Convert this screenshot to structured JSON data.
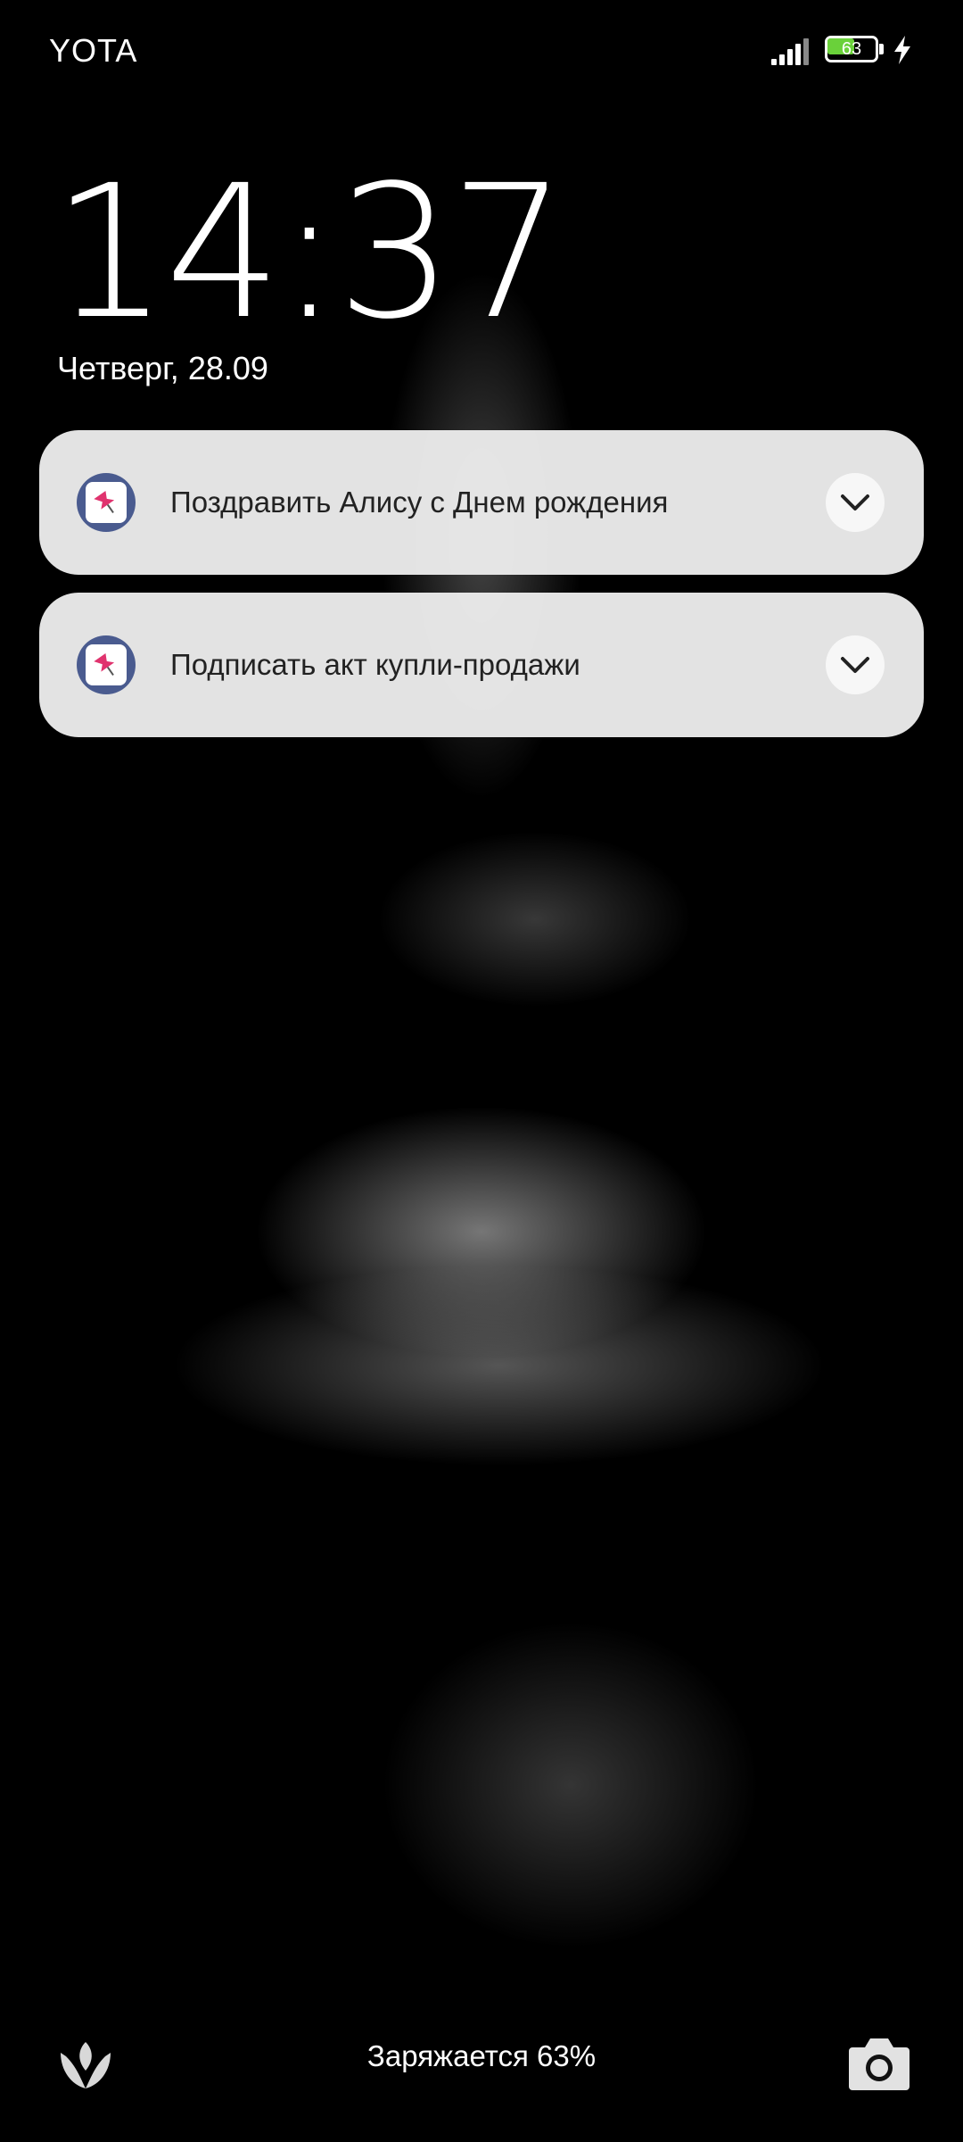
{
  "status_bar": {
    "carrier": "YOTA",
    "battery_level": "63",
    "battery_fraction": 0.63,
    "battery_fill_color": "#6ad13a",
    "signal_icon": "signal-bars-icon",
    "charging_icon": "bolt-icon"
  },
  "lockscreen": {
    "time": "14:37",
    "date": "Четверг, 28.09"
  },
  "notifications": [
    {
      "icon": "pin-app-icon",
      "title": "Поздравить Алису с Днем рождения",
      "expand_icon": "chevron-down-icon"
    },
    {
      "icon": "pin-app-icon",
      "title": "Подписать акт купли-продажи",
      "expand_icon": "chevron-down-icon"
    }
  ],
  "bottom_bar": {
    "left_shortcut_icon": "tulip-icon",
    "charging_status": "Заряжается 63%",
    "right_shortcut_icon": "camera-icon"
  },
  "colors": {
    "app_icon_ring": "#4a5b8f",
    "pin_accent": "#e0336e",
    "notification_bg": "#ececec"
  }
}
